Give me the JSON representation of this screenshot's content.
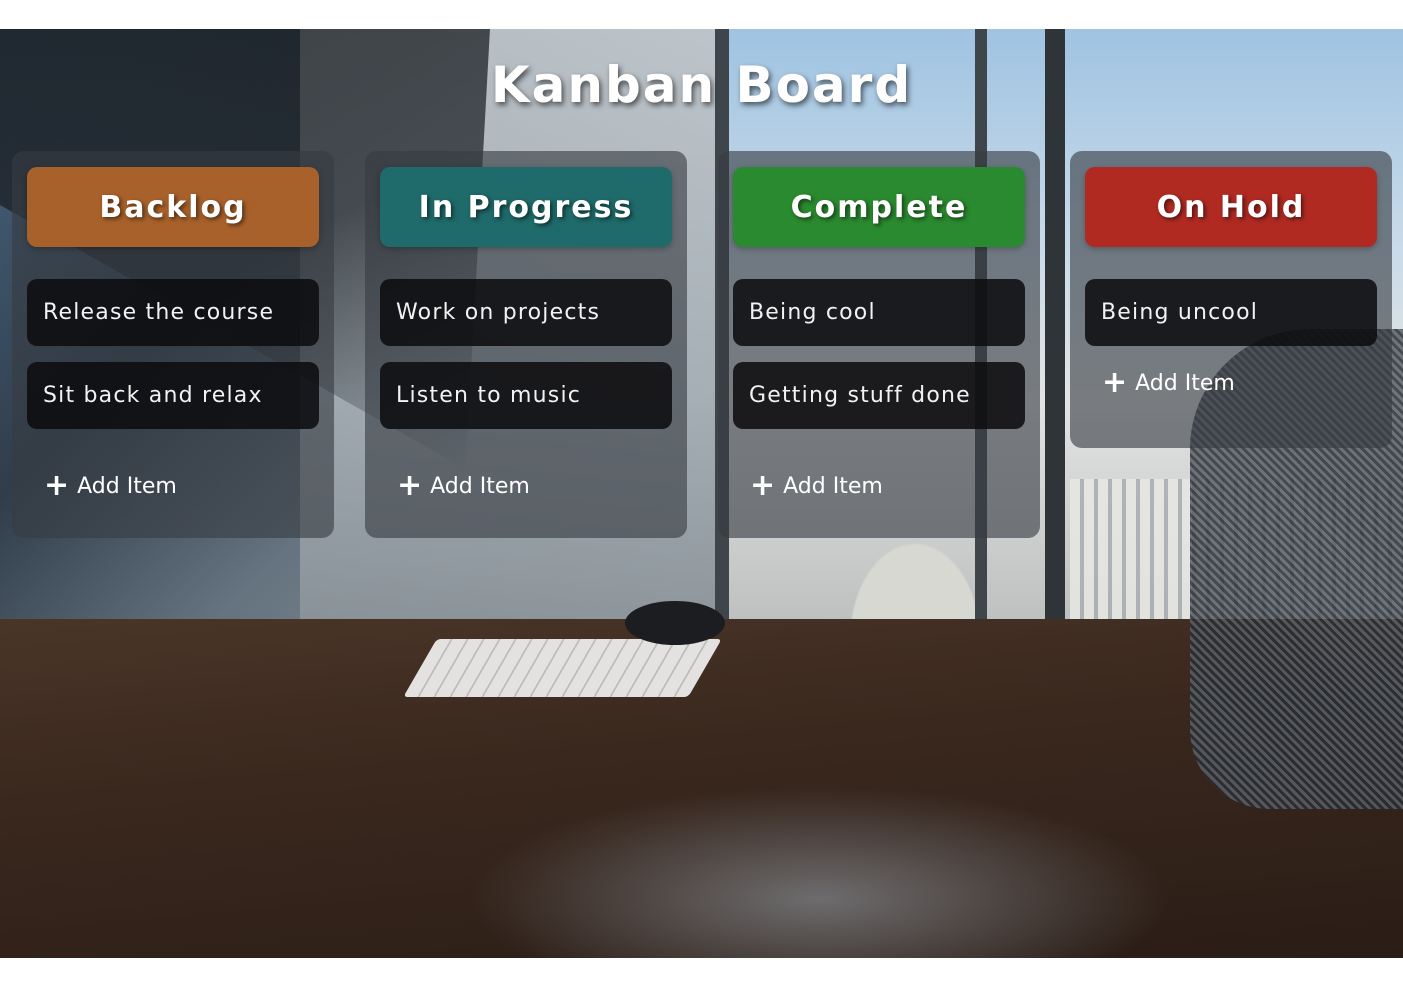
{
  "page": {
    "title": "Kanban Board"
  },
  "columns": [
    {
      "key": "backlog",
      "label": "Backlog",
      "color": "#a8612a",
      "items": [
        "Release the course",
        "Sit back and relax"
      ],
      "add_label": "Add Item",
      "add_icon": "+"
    },
    {
      "key": "progress",
      "label": "In Progress",
      "color": "#1f6a6a",
      "items": [
        "Work on projects",
        "Listen to music"
      ],
      "add_label": "Add Item",
      "add_icon": "+"
    },
    {
      "key": "complete",
      "label": "Complete",
      "color": "#2a8a2f",
      "items": [
        "Being cool",
        "Getting stuff done"
      ],
      "add_label": "Add Item",
      "add_icon": "+"
    },
    {
      "key": "onhold",
      "label": "On Hold",
      "color": "#b02a22",
      "items": [
        "Being uncool"
      ],
      "add_label": "Add Item",
      "add_icon": "+"
    }
  ]
}
